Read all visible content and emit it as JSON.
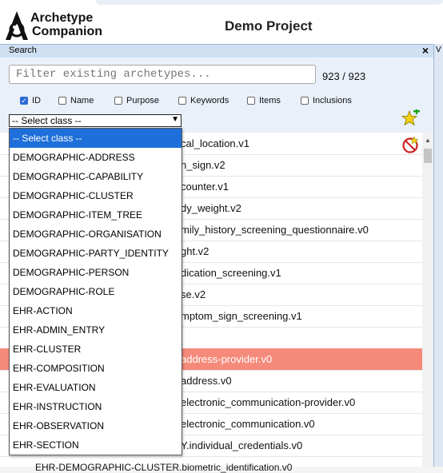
{
  "app": {
    "logo_line1": "Archetype",
    "logo_line2": "Companion",
    "project_title": "Demo Project"
  },
  "search_panel": {
    "title": "Search",
    "close": "×",
    "filter_placeholder": "Filter existing archetypes...",
    "count": "923 / 923",
    "checkboxes": [
      {
        "label": "ID",
        "checked": true
      },
      {
        "label": "Name",
        "checked": false
      },
      {
        "label": "Purpose",
        "checked": false
      },
      {
        "label": "Keywords",
        "checked": false
      },
      {
        "label": "Items",
        "checked": false
      },
      {
        "label": "Inclusions",
        "checked": false
      }
    ],
    "select_value": "-- Select class --"
  },
  "dropdown_options": [
    "-- Select class --",
    "DEMOGRAPHIC-ADDRESS",
    "DEMOGRAPHIC-CAPABILITY",
    "DEMOGRAPHIC-CLUSTER",
    "DEMOGRAPHIC-ITEM_TREE",
    "DEMOGRAPHIC-ORGANISATION",
    "DEMOGRAPHIC-PARTY_IDENTITY",
    "DEMOGRAPHIC-PERSON",
    "DEMOGRAPHIC-ROLE",
    "EHR-ACTION",
    "EHR-ADMIN_ENTRY",
    "EHR-CLUSTER",
    "EHR-COMPOSITION",
    "EHR-EVALUATION",
    "EHR-INSTRUCTION",
    "EHR-OBSERVATION",
    "EHR-SECTION"
  ],
  "archetype_rows": [
    {
      "text": "cal_location.v1",
      "selected": false
    },
    {
      "text": "n_sign.v2",
      "selected": false
    },
    {
      "text": "counter.v1",
      "selected": false
    },
    {
      "text": "dy_weight.v2",
      "selected": false
    },
    {
      "text": "mily_history_screening_questionnaire.v0",
      "selected": false
    },
    {
      "text": "ght.v2",
      "selected": false
    },
    {
      "text": "dication_screening.v1",
      "selected": false
    },
    {
      "text": "se.v2",
      "selected": false
    },
    {
      "text": "mptom_sign_screening.v1",
      "selected": false
    },
    {
      "text": "",
      "selected": false
    },
    {
      "text": "address-provider.v0",
      "selected": true
    },
    {
      "text": "address.v0",
      "selected": false
    },
    {
      "text": "electronic_communication-provider.v0",
      "selected": false
    },
    {
      "text": "electronic_communication.v0",
      "selected": false
    },
    {
      "text": "Y.individual_credentials.v0",
      "selected": false
    }
  ],
  "bottom_partial_row": "EHR-DEMOGRAPHIC-CLUSTER.biometric_identification.v0",
  "colors": {
    "selected_row": "#f58a7a",
    "dropdown_active": "#1e6fd9",
    "panel_header": "#cfe0f3"
  },
  "icons": [
    "archetype-logo-icon",
    "star-add-icon",
    "no-entry-icon",
    "close-icon",
    "chevron-down-icon"
  ]
}
